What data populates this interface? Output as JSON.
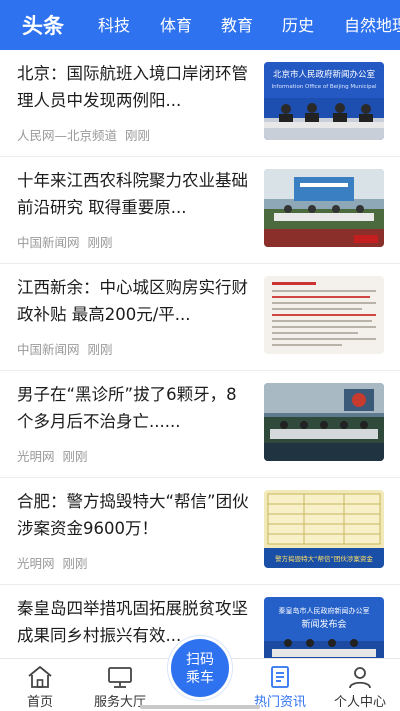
{
  "channels": [
    {
      "label": "头条",
      "active": true
    },
    {
      "label": "科技",
      "active": false
    },
    {
      "label": "体育",
      "active": false
    },
    {
      "label": "教育",
      "active": false
    },
    {
      "label": "历史",
      "active": false
    },
    {
      "label": "自然地理",
      "active": false
    }
  ],
  "news": [
    {
      "title": "北京：国际航班入境口岸闭环管理人员中发现两例阳...",
      "source": "人民网—北京频道",
      "time": "刚刚",
      "image_icon": "press-conference-photo",
      "image_text": "北京市人民政府新闻办公室",
      "image_text_en": "Information Office of Beijing Municipal"
    },
    {
      "title": "十年来江西农科院聚力农业基础前沿研究 取得重要原...",
      "source": "中国新闻网",
      "time": "刚刚",
      "image_icon": "conference-room-photo"
    },
    {
      "title": "江西新余：中心城区购房实行财政补贴 最高200元/平...",
      "source": "中国新闻网",
      "time": "刚刚",
      "image_icon": "policy-document-photo"
    },
    {
      "title": "男子在“黑诊所”拔了6颗牙，8个多月后不治身亡......",
      "source": "光明网",
      "time": "刚刚",
      "image_icon": "meeting-hall-photo"
    },
    {
      "title": "合肥：警方捣毁特大“帮信”团伙 涉案资金9600万！",
      "source": "光明网",
      "time": "刚刚",
      "image_icon": "police-table-photo",
      "image_text": "警方捣毁特大“帮信”团伙涉案资金"
    },
    {
      "title": "秦皇岛四举措巩固拓展脱贫攻坚成果同乡村振兴有效...",
      "source": "",
      "time": "",
      "image_icon": "press-release-stage-photo",
      "image_text": "秦皇岛市人民政府新闻办公室",
      "image_text_2": "新闻发布会"
    }
  ],
  "tabs": [
    {
      "label": "首页",
      "icon": "home-icon",
      "active": false
    },
    {
      "label": "服务大厅",
      "icon": "monitor-icon",
      "active": false
    },
    {
      "label": "热门资讯",
      "icon": "news-icon",
      "active": true
    },
    {
      "label": "个人中心",
      "icon": "person-icon",
      "active": false
    }
  ],
  "scan_button": {
    "line1": "扫码",
    "line2": "乘车"
  },
  "colors": {
    "brand": "#2f72f0",
    "text": "#1c1c1c",
    "meta": "#9a9a9a"
  }
}
